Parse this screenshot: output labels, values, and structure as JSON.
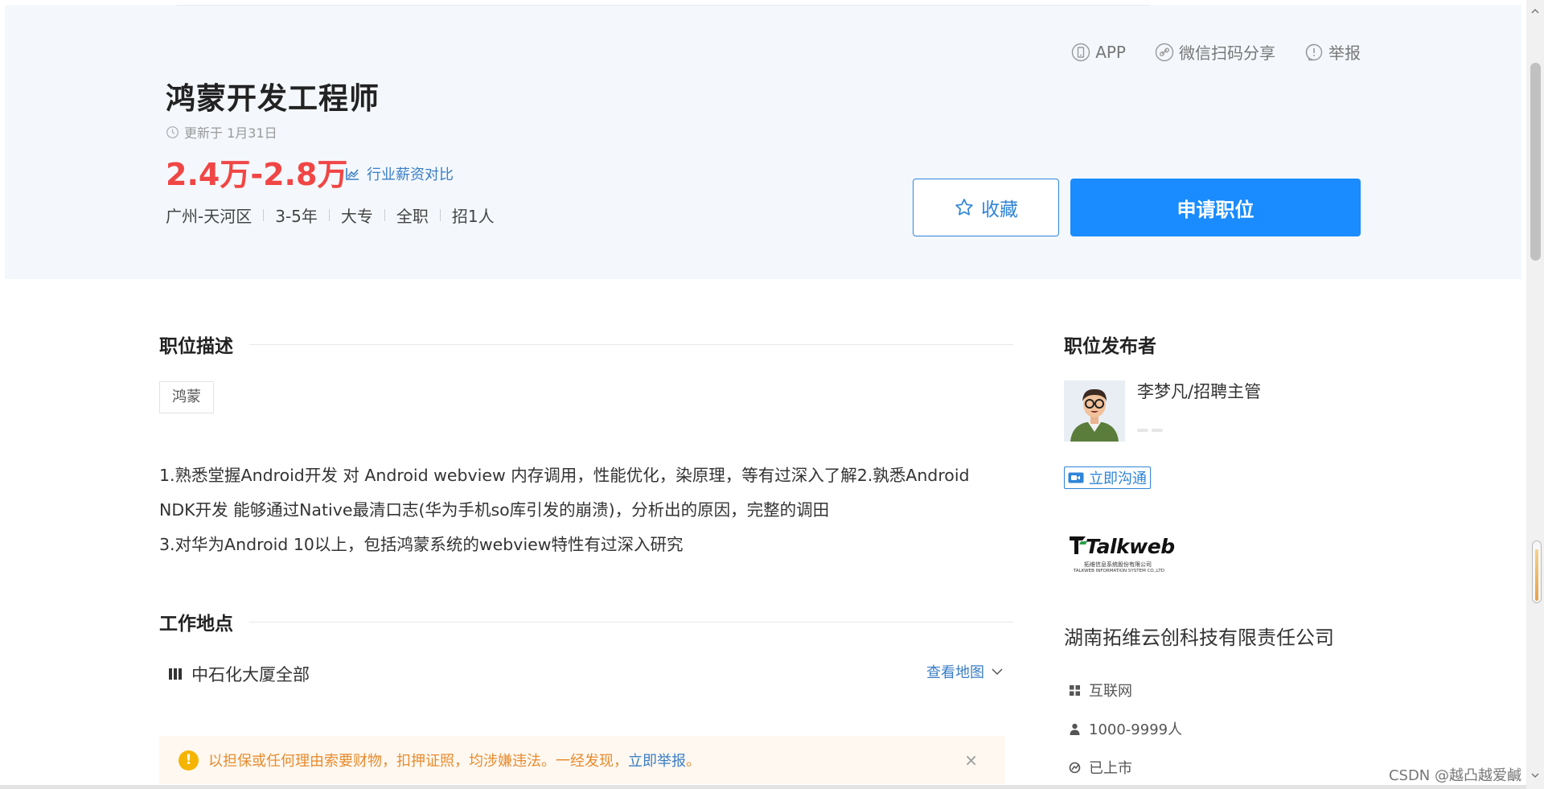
{
  "top_links": {
    "app": "APP",
    "wechat_share": "微信扫码分享",
    "report": "举报"
  },
  "job": {
    "title": "鸿蒙开发工程师",
    "updated": "更新于 1月31日",
    "salary": "2.4万-2.8万",
    "salary_compare": "行业薪资对比",
    "meta": [
      "广州-天河区",
      "3-5年",
      "大专",
      "全职",
      "招1人"
    ]
  },
  "actions": {
    "favorite": "收藏",
    "apply": "申请职位"
  },
  "description": {
    "heading": "职位描述",
    "tag": "鸿蒙",
    "lines": [
      "1.熟悉堂握Android开发 对 Android webview 内存调用，性能优化，染原理，等有过深入了解2.孰悉Android",
      "NDK开发 能够通过Native最清口志(华为手机so库引发的崩溃)，分析出的原因，完整的调田",
      "3.对华为Android 10以上，包括鸿蒙系统的webview特性有过深入研究"
    ]
  },
  "work_location": {
    "heading": "工作地点",
    "address": "中石化大厦全部",
    "view_map": "查看地图"
  },
  "warning": {
    "text": "以担保或任何理由索要财物，扣押证照，均涉嫌违法。一经发现，",
    "link": "立即举报",
    "end": "。",
    "close": "×"
  },
  "poster": {
    "heading": "职位发布者",
    "name": "李梦凡/招聘主管",
    "chat": "立即沟通"
  },
  "company": {
    "logo_wordmark": "Talkweb",
    "logo_cn": "拓维信息系统股份有限公司",
    "logo_en": "TALKWEB INFORMATION SYSTEM CO.,LTD",
    "name": "湖南拓维云创科技有限责任公司",
    "industry": "互联网",
    "size": "1000-9999人",
    "status": "已上市"
  },
  "watermark": "CSDN @越凸越爱鹹",
  "colors": {
    "salary_red": "#f04645",
    "primary_blue": "#1a8cff",
    "link_blue": "#3a7ec6",
    "hero_bg": "#f4f8fd",
    "warn_orange": "#e88b2e"
  }
}
